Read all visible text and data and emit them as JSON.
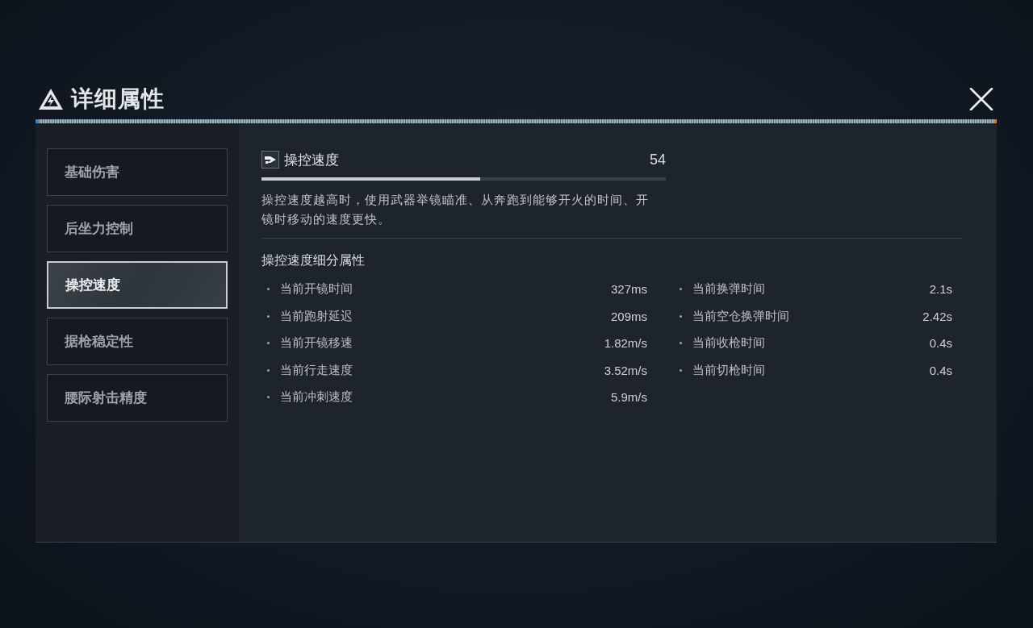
{
  "header": {
    "title": "详细属性"
  },
  "categories": [
    {
      "label": "基础伤害",
      "selected": false
    },
    {
      "label": "后坐力控制",
      "selected": false
    },
    {
      "label": "操控速度",
      "selected": true
    },
    {
      "label": "据枪稳定性",
      "selected": false
    },
    {
      "label": "腰际射击精度",
      "selected": false
    }
  ],
  "attribute": {
    "name": "操控速度",
    "value": "54",
    "level": 0.54,
    "description": "操控速度越高时，使用武器举镜瞄准、从奔跑到能够开火的时间、开镜时移动的速度更快。"
  },
  "breakdown": {
    "title": "操控速度细分属性",
    "columns": [
      [
        {
          "label": "当前开镜时间",
          "value": "327ms"
        },
        {
          "label": "当前跑射延迟",
          "value": "209ms"
        },
        {
          "label": "当前开镜移速",
          "value": "1.82m/s"
        },
        {
          "label": "当前行走速度",
          "value": "3.52m/s"
        },
        {
          "label": "当前冲刺速度",
          "value": "5.9m/s"
        }
      ],
      [
        {
          "label": "当前换弹时间",
          "value": "2.1s"
        },
        {
          "label": "当前空仓换弹时间",
          "value": "2.42s"
        },
        {
          "label": "当前收枪时间",
          "value": "0.4s"
        },
        {
          "label": "当前切枪时间",
          "value": "0.4s"
        }
      ]
    ]
  }
}
